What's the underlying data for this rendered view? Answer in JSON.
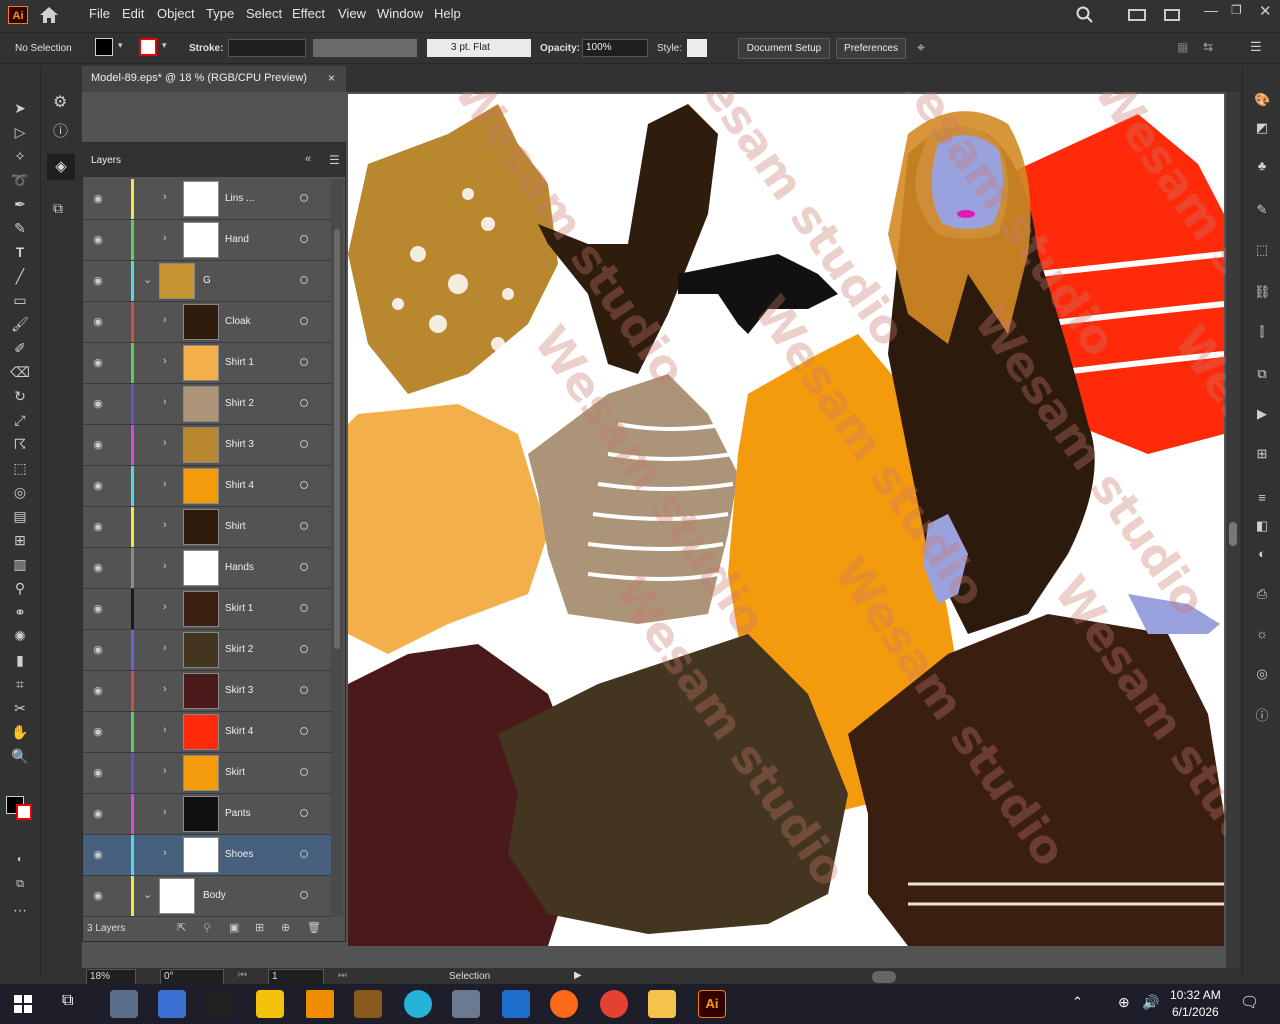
{
  "app": {
    "logo": "Ai"
  },
  "menu": [
    "File",
    "Edit",
    "Object",
    "Type",
    "Select",
    "Effect",
    "View",
    "Window",
    "Help"
  ],
  "control": {
    "selection_state": "No Selection",
    "stroke_label": "Stroke:",
    "stroke_profile": "3 pt. Flat",
    "opacity_label": "Opacity:",
    "opacity_value": "100%",
    "style_label": "Style:",
    "document_setup": "Document Setup",
    "preferences": "Preferences"
  },
  "document": {
    "tab_title": "Model-89.eps* @ 18 % (RGB/CPU Preview)",
    "close": "×"
  },
  "layers_panel": {
    "title": "Layers",
    "count_label": "3 Layers",
    "rows": [
      {
        "name": "Lins ...",
        "color": "#f2e34a",
        "indent": 1
      },
      {
        "name": "Hand",
        "color": "#5bd05b",
        "indent": 1
      },
      {
        "name": "G",
        "color": "#57d6e0",
        "indent": 0,
        "expanded": true
      },
      {
        "name": "Cloak",
        "color": "#d84a4a",
        "indent": 1
      },
      {
        "name": "Shirt 1",
        "color": "#5bd05b",
        "indent": 1
      },
      {
        "name": "Shirt 2",
        "color": "#5a57c8",
        "indent": 1
      },
      {
        "name": "Shirt 3",
        "color": "#d74ad7",
        "indent": 1
      },
      {
        "name": "Shirt 4",
        "color": "#57d6e0",
        "indent": 1
      },
      {
        "name": "Shirt",
        "color": "#f2e34a",
        "indent": 1
      },
      {
        "name": "Hands",
        "color": "#8a8a8a",
        "indent": 1
      },
      {
        "name": "Skirt 1",
        "color": "#1a1a1a",
        "indent": 1
      },
      {
        "name": "Skirt 2",
        "color": "#5a6ad8",
        "indent": 1
      },
      {
        "name": "Skirt 3",
        "color": "#d84a4a",
        "indent": 1
      },
      {
        "name": "Skirt 4",
        "color": "#5bd05b",
        "indent": 1
      },
      {
        "name": "Skirt",
        "color": "#5a57c8",
        "indent": 1
      },
      {
        "name": "Pants",
        "color": "#d74ad7",
        "indent": 1
      },
      {
        "name": "Shoes",
        "color": "#57d6e0",
        "indent": 1,
        "selected": true
      },
      {
        "name": "Body",
        "color": "#f2e34a",
        "indent": 0,
        "expanded": true
      }
    ]
  },
  "status": {
    "zoom": "18%",
    "rotation": "0°",
    "artboard": "1",
    "tool": "Selection"
  },
  "watermark": "Wesam studio",
  "taskbar": {
    "time": "10:32 AM",
    "date": "6/1/2026",
    "ai": "Ai"
  },
  "colors": {
    "accent": "#ff9a00",
    "selected_row": "#46607e"
  }
}
